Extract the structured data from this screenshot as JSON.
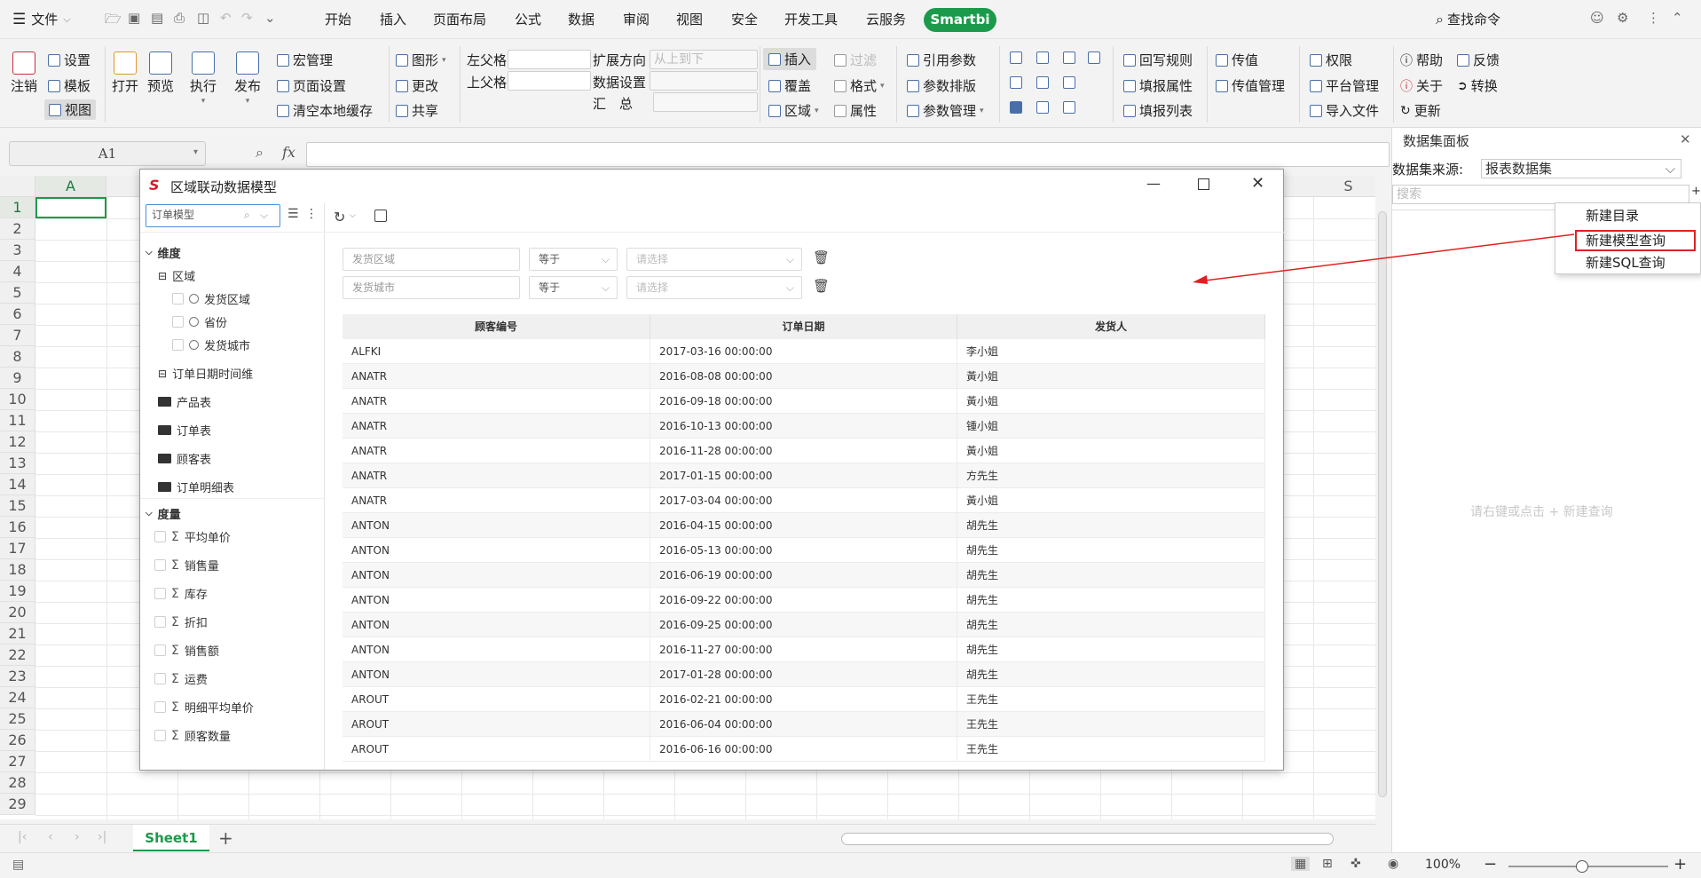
{
  "menubar": {
    "file_label": "文件",
    "items": [
      "开始",
      "插入",
      "页面布局",
      "公式",
      "数据",
      "审阅",
      "视图",
      "安全",
      "开发工具",
      "云服务"
    ],
    "smartbi": "Smartbi",
    "search_cmd": "查找命令"
  },
  "ribbon": {
    "logout": "注销",
    "settings": "设置",
    "template": "模板",
    "view": "视图",
    "open": "打开",
    "preview": "预览",
    "execute": "执行",
    "publish": "发布",
    "macro": "宏管理",
    "page_setup": "页面设置",
    "clear_cache": "清空本地缓存",
    "graphic": "图形",
    "change": "更改",
    "share": "共享",
    "left_parent": "左父格",
    "top_parent": "上父格",
    "expand_dir": "扩展方向",
    "expand_value": "从上到下",
    "data_setting": "数据设置",
    "summary": "汇　总",
    "insert": "插入",
    "cover": "覆盖",
    "area": "区域",
    "filter": "过滤",
    "format": "格式",
    "property": "属性",
    "ref_param": "引用参数",
    "param_layout": "参数排版",
    "param_manage": "参数管理",
    "writeback": "回写规则",
    "fill_prop": "填报属性",
    "fill_list": "填报列表",
    "pass_value": "传值",
    "pass_manage": "传值管理",
    "permission": "权限",
    "platform": "平台管理",
    "import_file": "导入文件",
    "help": "帮助",
    "feedback": "反馈",
    "about": "关于",
    "convert": "转换",
    "update": "更新"
  },
  "formula": {
    "cell_ref": "A1",
    "fx": "fx"
  },
  "sheet": {
    "col_a": "A",
    "col_s": "S",
    "rows": [
      "1",
      "2",
      "3",
      "4",
      "5",
      "6",
      "7",
      "8",
      "9",
      "10",
      "11",
      "12",
      "13",
      "14",
      "15",
      "16",
      "17",
      "18",
      "19",
      "20",
      "21",
      "22",
      "23",
      "24",
      "25",
      "26",
      "27",
      "28",
      "29"
    ],
    "tab": "Sheet1"
  },
  "status": {
    "zoom": "100%"
  },
  "panel": {
    "title": "数据集面板",
    "source_label": "数据集来源:",
    "source_value": "报表数据集",
    "search_placeholder": "搜索",
    "hint": "请右键或点击 + 新建查询"
  },
  "context_menu": {
    "items": [
      "新建目录",
      "新建模型查询",
      "新建SQL查询"
    ]
  },
  "dialog": {
    "title": "区域联动数据模型",
    "model_select": "订单模型",
    "tree": {
      "dimension": "维度",
      "region": "区域",
      "region_children": [
        "发货区域",
        "省份",
        "发货城市"
      ],
      "date_dim": "订单日期时间维",
      "tables": [
        "产品表",
        "订单表",
        "顾客表",
        "订单明细表"
      ],
      "measure": "度量",
      "measures": [
        "平均单价",
        "销售量",
        "库存",
        "折扣",
        "销售额",
        "运费",
        "明细平均单价",
        "顾客数量"
      ]
    },
    "filters": [
      {
        "field": "发货区域",
        "op": "等于",
        "value_placeholder": "请选择"
      },
      {
        "field": "发货城市",
        "op": "等于",
        "value_placeholder": "请选择"
      }
    ],
    "table": {
      "headers": [
        "顾客编号",
        "订单日期",
        "发货人"
      ],
      "rows": [
        [
          "ALFKI",
          "2017-03-16 00:00:00",
          "李小姐"
        ],
        [
          "ANATR",
          "2016-08-08 00:00:00",
          "黃小姐"
        ],
        [
          "ANATR",
          "2016-09-18 00:00:00",
          "黃小姐"
        ],
        [
          "ANATR",
          "2016-10-13 00:00:00",
          "锺小姐"
        ],
        [
          "ANATR",
          "2016-11-28 00:00:00",
          "黃小姐"
        ],
        [
          "ANATR",
          "2017-01-15 00:00:00",
          "方先生"
        ],
        [
          "ANATR",
          "2017-03-04 00:00:00",
          "黃小姐"
        ],
        [
          "ANTON",
          "2016-04-15 00:00:00",
          "胡先生"
        ],
        [
          "ANTON",
          "2016-05-13 00:00:00",
          "胡先生"
        ],
        [
          "ANTON",
          "2016-06-19 00:00:00",
          "胡先生"
        ],
        [
          "ANTON",
          "2016-09-22 00:00:00",
          "胡先生"
        ],
        [
          "ANTON",
          "2016-09-25 00:00:00",
          "胡先生"
        ],
        [
          "ANTON",
          "2016-11-27 00:00:00",
          "胡先生"
        ],
        [
          "ANTON",
          "2017-01-28 00:00:00",
          "胡先生"
        ],
        [
          "AROUT",
          "2016-02-21 00:00:00",
          "王先生"
        ],
        [
          "AROUT",
          "2016-06-04 00:00:00",
          "王先生"
        ],
        [
          "AROUT",
          "2016-06-16 00:00:00",
          "王先生"
        ]
      ]
    }
  },
  "colors": {
    "accent_green": "#1c9a4b",
    "highlight_red": "#e02020",
    "brand_red": "#d0202a"
  }
}
